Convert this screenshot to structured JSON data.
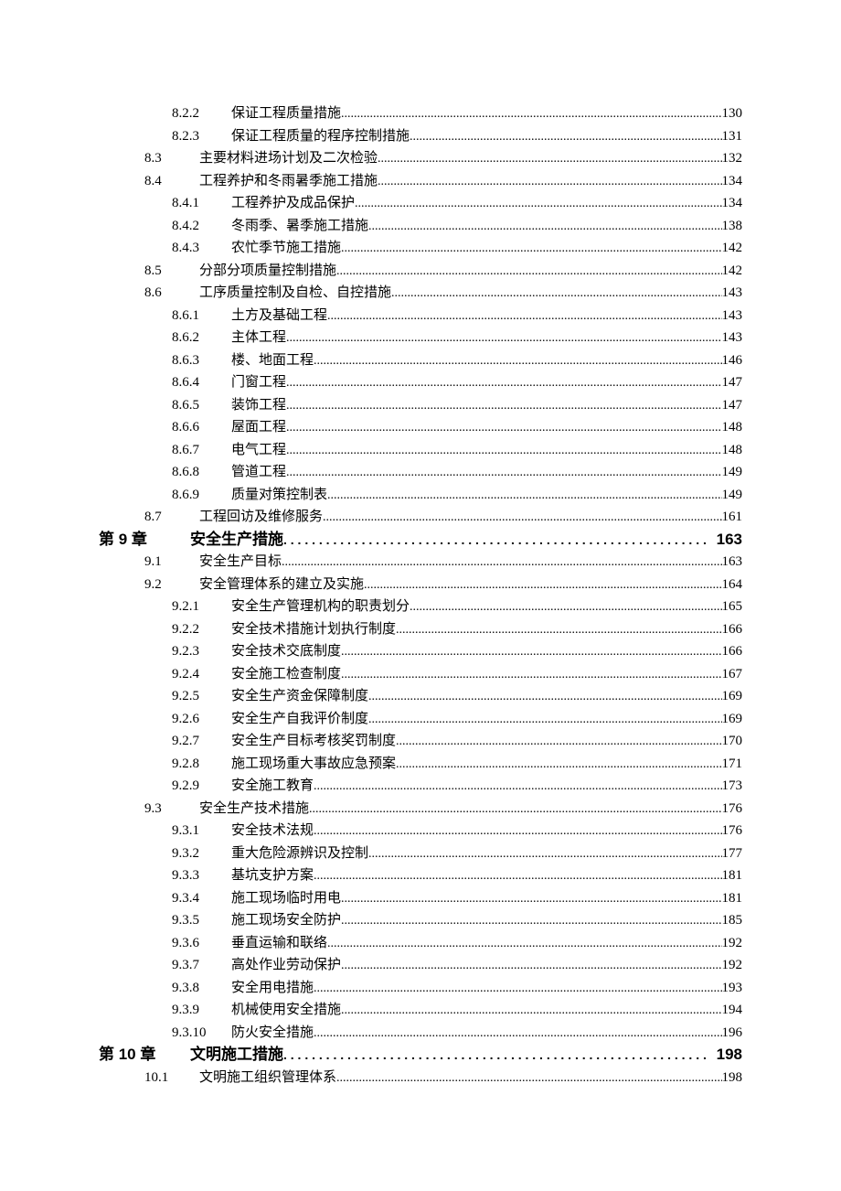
{
  "toc": [
    {
      "level": "l3",
      "num": "8.2.2",
      "title": "保证工程质量措施",
      "page": "130"
    },
    {
      "level": "l3",
      "num": "8.2.3",
      "title": "保证工程质量的程序控制措施",
      "page": "131"
    },
    {
      "level": "l2",
      "num": "8.3",
      "title": "主要材料进场计划及二次检验",
      "page": "132"
    },
    {
      "level": "l2",
      "num": "8.4",
      "title": "工程养护和冬雨暑季施工措施",
      "page": "134"
    },
    {
      "level": "l3",
      "num": "8.4.1",
      "title": "工程养护及成品保护",
      "page": "134"
    },
    {
      "level": "l3",
      "num": "8.4.2",
      "title": "冬雨季、暑季施工措施",
      "page": "138"
    },
    {
      "level": "l3",
      "num": "8.4.3",
      "title": "农忙季节施工措施",
      "page": "142"
    },
    {
      "level": "l2",
      "num": "8.5",
      "title": "分部分项质量控制措施",
      "page": "142"
    },
    {
      "level": "l2",
      "num": "8.6",
      "title": "工序质量控制及自检、自控措施",
      "page": "143"
    },
    {
      "level": "l3",
      "num": "8.6.1",
      "title": "土方及基础工程",
      "page": "143"
    },
    {
      "level": "l3",
      "num": "8.6.2",
      "title": "主体工程",
      "page": "143"
    },
    {
      "level": "l3",
      "num": "8.6.3",
      "title": "楼、地面工程",
      "page": "146"
    },
    {
      "level": "l3",
      "num": "8.6.4",
      "title": "门窗工程",
      "page": "147"
    },
    {
      "level": "l3",
      "num": "8.6.5",
      "title": "装饰工程",
      "page": "147"
    },
    {
      "level": "l3",
      "num": "8.6.6",
      "title": "屋面工程",
      "page": "148"
    },
    {
      "level": "l3",
      "num": "8.6.7",
      "title": "电气工程",
      "page": "148"
    },
    {
      "level": "l3",
      "num": "8.6.8",
      "title": "管道工程",
      "page": "149"
    },
    {
      "level": "l3",
      "num": "8.6.9",
      "title": "质量对策控制表",
      "page": "149"
    },
    {
      "level": "l2",
      "num": "8.7",
      "title": "工程回访及维修服务",
      "page": "161"
    },
    {
      "level": "chapter",
      "num": "第 9 章",
      "title": "安全生产措施",
      "page": "163"
    },
    {
      "level": "l2",
      "num": "9.1",
      "title": "安全生产目标",
      "page": "163"
    },
    {
      "level": "l2",
      "num": "9.2",
      "title": "安全管理体系的建立及实施",
      "page": "164"
    },
    {
      "level": "l3",
      "num": "9.2.1",
      "title": "安全生产管理机构的职责划分",
      "page": "165"
    },
    {
      "level": "l3",
      "num": "9.2.2",
      "title": "安全技术措施计划执行制度",
      "page": "166"
    },
    {
      "level": "l3",
      "num": "9.2.3",
      "title": "安全技术交底制度",
      "page": "166"
    },
    {
      "level": "l3",
      "num": "9.2.4",
      "title": "安全施工检查制度",
      "page": "167"
    },
    {
      "level": "l3",
      "num": "9.2.5",
      "title": "安全生产资金保障制度",
      "page": "169"
    },
    {
      "level": "l3",
      "num": "9.2.6",
      "title": "安全生产自我评价制度",
      "page": "169"
    },
    {
      "level": "l3",
      "num": "9.2.7",
      "title": "安全生产目标考核奖罚制度",
      "page": "170"
    },
    {
      "level": "l3",
      "num": "9.2.8",
      "title": "施工现场重大事故应急预案",
      "page": "171"
    },
    {
      "level": "l3",
      "num": "9.2.9",
      "title": "安全施工教育",
      "page": "173"
    },
    {
      "level": "l2",
      "num": "9.3",
      "title": "安全生产技术措施",
      "page": "176"
    },
    {
      "level": "l3",
      "num": "9.3.1",
      "title": "安全技术法规",
      "page": "176"
    },
    {
      "level": "l3",
      "num": "9.3.2",
      "title": "重大危险源辨识及控制",
      "page": "177"
    },
    {
      "level": "l3",
      "num": "9.3.3",
      "title": "基坑支护方案",
      "page": "181"
    },
    {
      "level": "l3",
      "num": "9.3.4",
      "title": "施工现场临时用电",
      "page": "181"
    },
    {
      "level": "l3",
      "num": "9.3.5",
      "title": "施工现场安全防护",
      "page": "185"
    },
    {
      "level": "l3",
      "num": "9.3.6",
      "title": "垂直运输和联络",
      "page": "192"
    },
    {
      "level": "l3",
      "num": "9.3.7",
      "title": "高处作业劳动保护",
      "page": "192"
    },
    {
      "level": "l3",
      "num": "9.3.8",
      "title": "安全用电措施",
      "page": "193"
    },
    {
      "level": "l3",
      "num": "9.3.9",
      "title": "机械使用安全措施",
      "page": "194"
    },
    {
      "level": "l3",
      "num": "9.3.10",
      "title": "防火安全措施",
      "page": "196"
    },
    {
      "level": "chapter",
      "num": "第 10 章",
      "title": "文明施工措施",
      "page": "198"
    },
    {
      "level": "l2",
      "num": "10.1",
      "title": "文明施工组织管理体系",
      "page": "198"
    }
  ]
}
